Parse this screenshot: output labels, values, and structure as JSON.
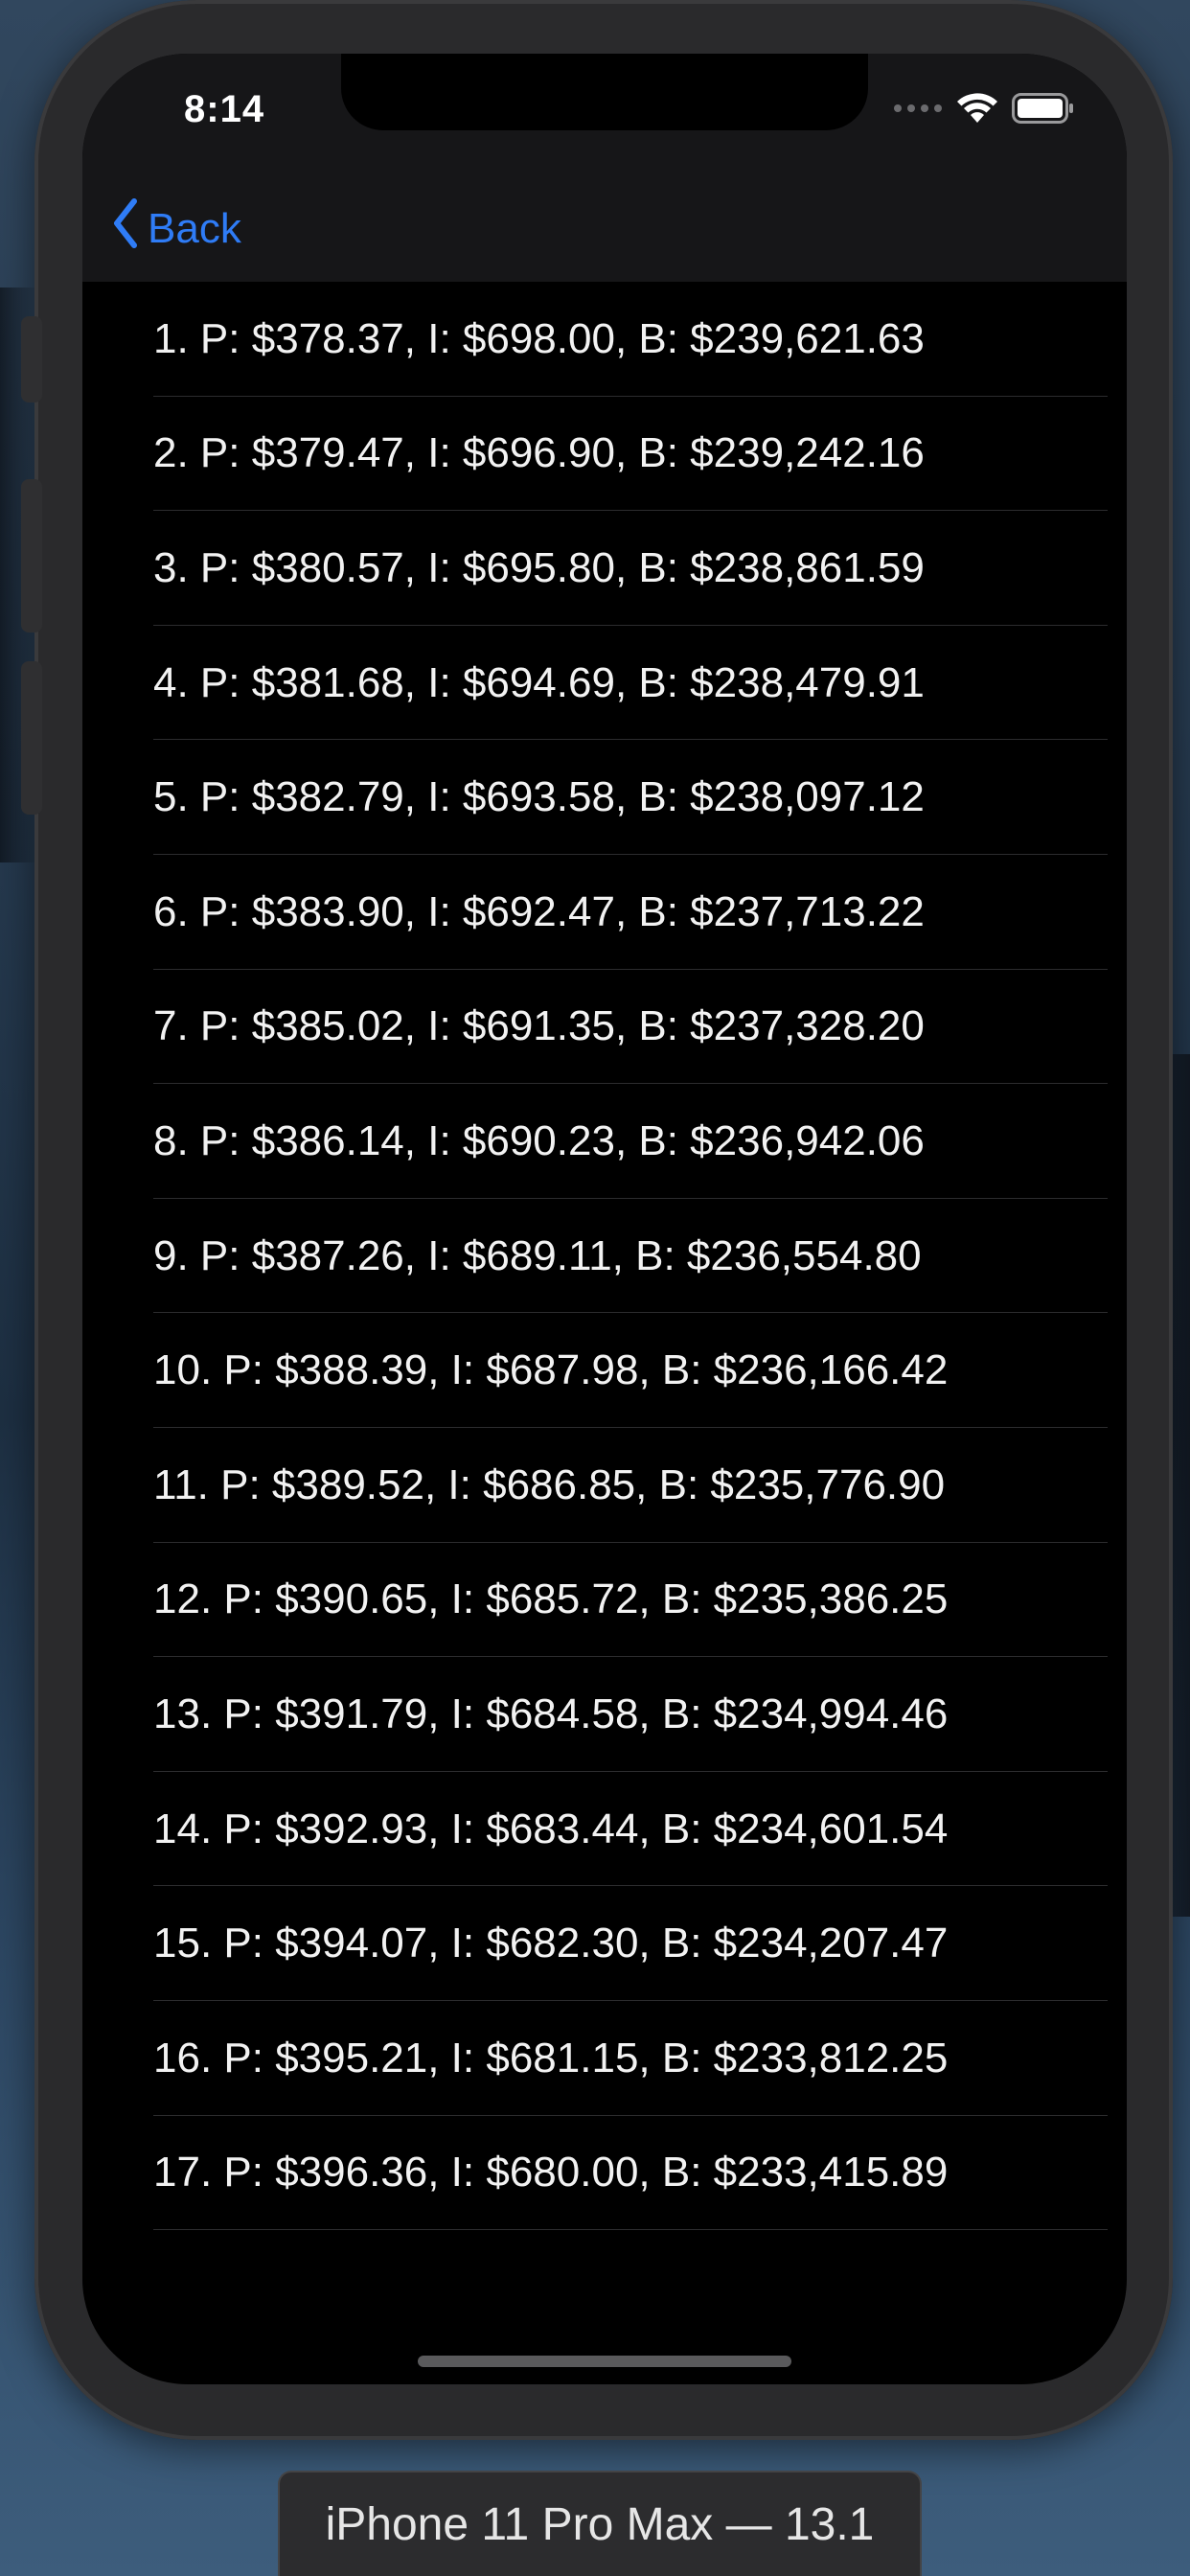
{
  "status_bar": {
    "time": "8:14"
  },
  "nav": {
    "back_label": "Back"
  },
  "payments": [
    "1. P: $378.37, I: $698.00, B: $239,621.63",
    "2. P: $379.47, I: $696.90, B: $239,242.16",
    "3. P: $380.57, I: $695.80, B: $238,861.59",
    "4. P: $381.68, I: $694.69, B: $238,479.91",
    "5. P: $382.79, I: $693.58, B: $238,097.12",
    "6. P: $383.90, I: $692.47, B: $237,713.22",
    "7. P: $385.02, I: $691.35, B: $237,328.20",
    "8. P: $386.14, I: $690.23, B: $236,942.06",
    "9. P: $387.26, I: $689.11, B: $236,554.80",
    "10. P: $388.39, I: $687.98, B: $236,166.42",
    "11. P: $389.52, I: $686.85, B: $235,776.90",
    "12. P: $390.65, I: $685.72, B: $235,386.25",
    "13. P: $391.79, I: $684.58, B: $234,994.46",
    "14. P: $392.93, I: $683.44, B: $234,601.54",
    "15. P: $394.07, I: $682.30, B: $234,207.47",
    "16. P: $395.21, I: $681.15, B: $233,812.25",
    "17. P: $396.36, I: $680.00, B: $233,415.89"
  ],
  "simulator": {
    "device_label": "iPhone 11 Pro Max — 13.1"
  },
  "colors": {
    "accent": "#2f7cf6",
    "screen_background": "#000000",
    "nav_background": "#161618",
    "text": "#f2f2f2"
  },
  "icons": [
    "chevron-left-icon",
    "cellular-signal-icon",
    "wifi-icon",
    "battery-icon"
  ]
}
